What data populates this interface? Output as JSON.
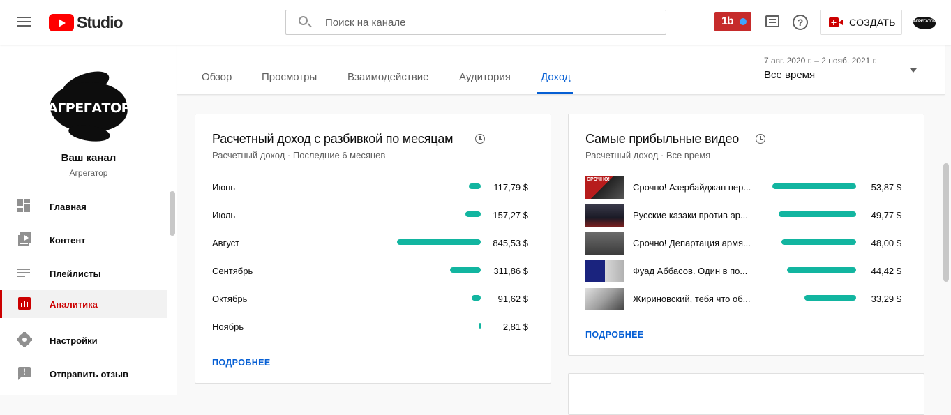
{
  "header": {
    "logo_text": "Studio",
    "search_placeholder": "Поиск на канале",
    "badge_text": "1b",
    "create_label": "СОЗДАТЬ",
    "avatar_text": "АГРЕГАТОР"
  },
  "sidebar": {
    "channel_logo_text": "АГРЕГАТОР",
    "channel_title": "Ваш канал",
    "channel_name": "Агрегатор",
    "items": [
      {
        "label": "Главная",
        "icon": "dashboard-icon"
      },
      {
        "label": "Контент",
        "icon": "content-icon"
      },
      {
        "label": "Плейлисты",
        "icon": "playlists-icon"
      },
      {
        "label": "Аналитика",
        "icon": "analytics-icon",
        "active": true
      },
      {
        "label": "Настройки",
        "icon": "settings-icon"
      },
      {
        "label": "Отправить отзыв",
        "icon": "feedback-icon"
      }
    ]
  },
  "tabs": {
    "items": [
      "Обзор",
      "Просмотры",
      "Взаимодействие",
      "Аудитория",
      "Доход"
    ],
    "active": "Доход",
    "date_range": "7 авг. 2020 г. – 2 нояб. 2021 г.",
    "period": "Все время"
  },
  "monthly_card": {
    "title": "Расчетный доход с разбивкой по месяцам",
    "subtitle": "Расчетный доход · Последние 6 месяцев",
    "more": "ПОДРОБНЕЕ",
    "rows": [
      {
        "label": "Июнь",
        "value": "117,79 $",
        "amount": 117.79
      },
      {
        "label": "Июль",
        "value": "157,27 $",
        "amount": 157.27
      },
      {
        "label": "Август",
        "value": "845,53 $",
        "amount": 845.53
      },
      {
        "label": "Сентябрь",
        "value": "311,86 $",
        "amount": 311.86
      },
      {
        "label": "Октябрь",
        "value": "91,62 $",
        "amount": 91.62
      },
      {
        "label": "Ноябрь",
        "value": "2,81 $",
        "amount": 2.81
      }
    ]
  },
  "top_videos_card": {
    "title": "Самые прибыльные видео",
    "subtitle": "Расчетный доход · Все время",
    "more": "ПОДРОБНЕЕ",
    "rows": [
      {
        "title": "Срочно! Азербайджан пер...",
        "value": "53,87 $",
        "amount": 53.87,
        "thumb_text": "СРОЧНО!"
      },
      {
        "title": "Русские казаки против ар...",
        "value": "49,77 $",
        "amount": 49.77,
        "thumb_text": ""
      },
      {
        "title": "Срочно! Департация армя...",
        "value": "48,00 $",
        "amount": 48.0,
        "thumb_text": ""
      },
      {
        "title": "Фуад Аббасов. Один в по...",
        "value": "44,42 $",
        "amount": 44.42,
        "thumb_text": ""
      },
      {
        "title": "Жириновский, тебя что об...",
        "value": "33,29 $",
        "amount": 33.29,
        "thumb_text": ""
      }
    ]
  },
  "colors": {
    "accent": "#065fd4",
    "bar": "#12b5a0",
    "brand_red": "#cc0000"
  }
}
